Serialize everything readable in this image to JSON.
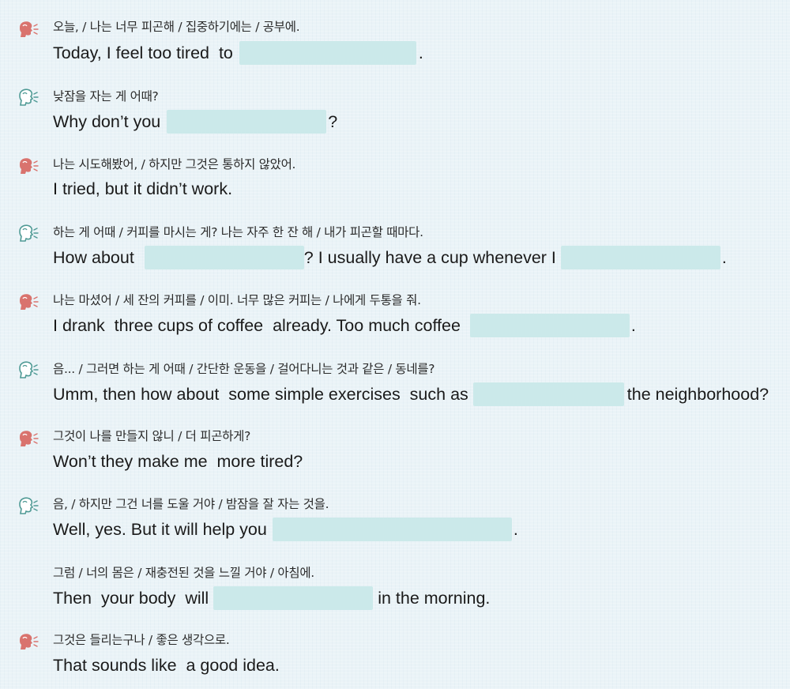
{
  "colors": {
    "background": "#eaf3f7",
    "blank": "#cbe9ea",
    "speaker_a": "#d9736e",
    "speaker_b": "#4f9a95"
  },
  "lines": [
    {
      "speaker": "a",
      "ko": "오늘, / 나는 너무 피곤해 / 집중하기에는 / 공부에.",
      "en": [
        "Today, I feel too tired  to",
        "",
        "."
      ]
    },
    {
      "speaker": "b",
      "ko": "낮잠을 자는 게 어때?",
      "en": [
        "Why don’t you",
        "",
        "?"
      ]
    },
    {
      "speaker": "a",
      "ko": "나는 시도해봤어, / 하지만 그것은 통하지 않았어.",
      "en": [
        "I tried, but it didn’t work."
      ]
    },
    {
      "speaker": "b",
      "ko": "하는 게 어때 / 커피를 마시는 게? 나는 자주 한 잔 해 / 내가 피곤할 때마다.",
      "en": [
        "How about",
        "",
        "? I usually have a cup whenever I",
        "",
        "."
      ]
    },
    {
      "speaker": "a",
      "ko": "나는 마셨어 / 세 잔의 커피를 / 이미. 너무 많은 커피는 / 나에게 두통을 줘.",
      "en": [
        "I drank  three cups of coffee  already. Too much coffee",
        "",
        "."
      ]
    },
    {
      "speaker": "b",
      "ko": "음... / 그러면 하는 게 어때 / 간단한 운동을 / 걸어다니는 것과 같은 / 동네를?",
      "en": [
        "Umm, then how about  some simple exercises  such as",
        "",
        "the neighborhood?"
      ]
    },
    {
      "speaker": "a",
      "ko": "그것이 나를 만들지 않니 / 더 피곤하게?",
      "en": [
        "Won’t they make me  more tired?"
      ]
    },
    {
      "speaker": "b",
      "ko": "음, / 하지만 그건 너를 도울 거야 / 밤잠을 잘 자는 것을.",
      "en": [
        "Well, yes. But it will help you",
        "",
        "."
      ]
    },
    {
      "speaker": "",
      "ko": "그럼 / 너의 몸은 / 재충전된 것을 느낄 거야 / 아침에.",
      "en": [
        "Then  your body  will",
        "",
        "in the morning."
      ]
    },
    {
      "speaker": "a",
      "ko": "그것은 들리는구나 / 좋은 생각으로.",
      "en": [
        "That sounds like  a good idea."
      ]
    }
  ]
}
